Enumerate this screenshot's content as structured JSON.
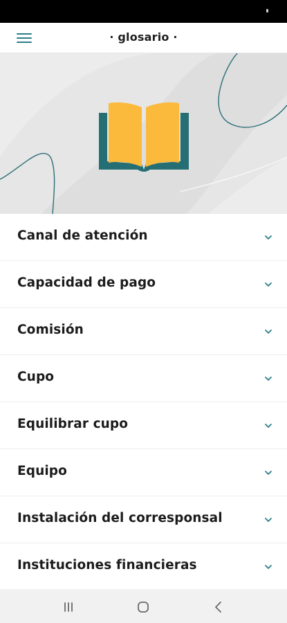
{
  "header": {
    "title": "· glosario ·",
    "menu_icon": "hamburger-menu-icon"
  },
  "hero": {
    "icon": "open-book-icon",
    "colors": {
      "book_pages": "#FBBA3B",
      "book_cover": "#246E74",
      "background": "#E6E6E6"
    }
  },
  "glossary": {
    "items": [
      {
        "label": "Canal de atención"
      },
      {
        "label": "Capacidad de pago"
      },
      {
        "label": "Comisión"
      },
      {
        "label": "Cupo"
      },
      {
        "label": "Equilibrar cupo"
      },
      {
        "label": "Equipo"
      },
      {
        "label": "Instalación del corresponsal"
      },
      {
        "label": "Instituciones financieras"
      }
    ],
    "expand_icon": "chevron-down-icon"
  },
  "system_nav": {
    "buttons": [
      "recent-apps-icon",
      "home-icon",
      "back-icon"
    ]
  },
  "colors": {
    "accent": "#2A7D88",
    "text": "#1B1B1B"
  }
}
